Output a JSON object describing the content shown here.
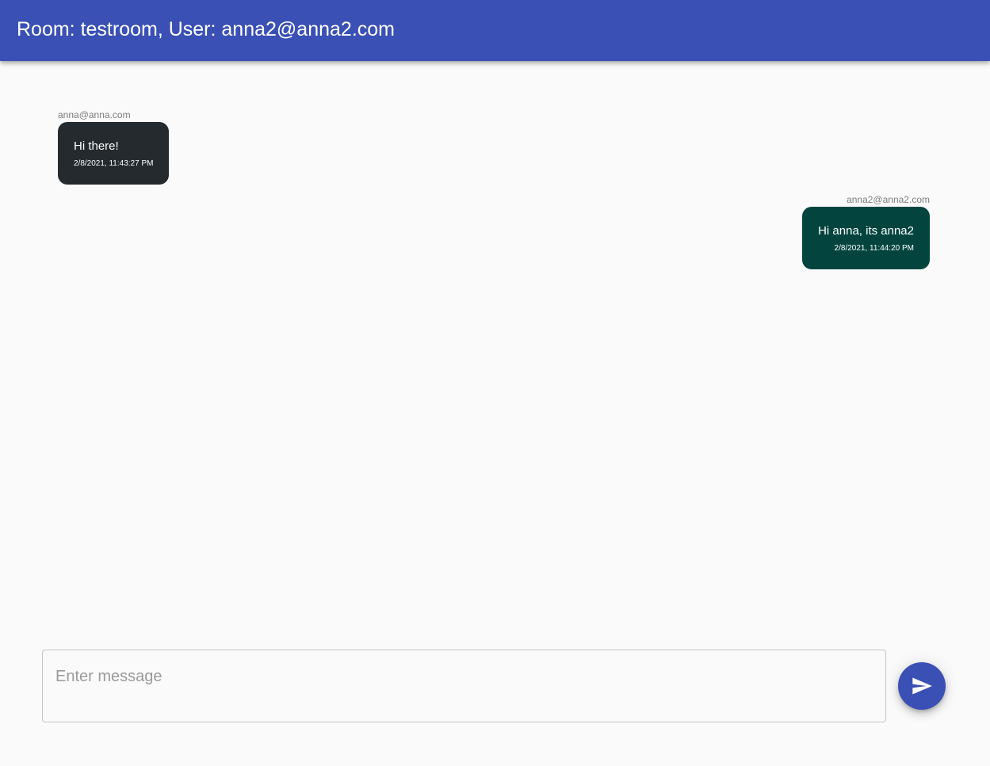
{
  "header": {
    "title": "Room: testroom, User: anna2@anna2.com"
  },
  "messages": [
    {
      "sender": "anna@anna.com",
      "text": "Hi there!",
      "timestamp": "2/8/2021, 11:43:27 PM",
      "color": "#252a2e",
      "align": "left"
    },
    {
      "sender": "anna2@anna2.com",
      "text": "Hi anna, its anna2",
      "timestamp": "2/8/2021, 11:44:20 PM",
      "color": "#03453e",
      "align": "right"
    }
  ],
  "composer": {
    "placeholder": "Enter message",
    "value": "",
    "send_icon": "send-icon"
  },
  "colors": {
    "primary": "#3a50b5",
    "background": "#fafafa"
  }
}
